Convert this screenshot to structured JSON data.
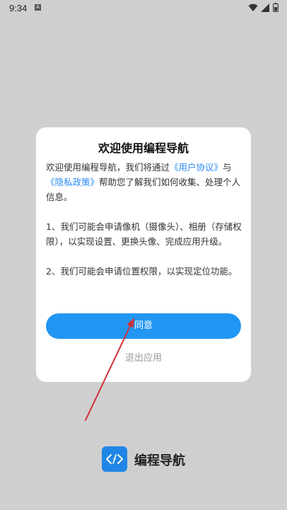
{
  "status_bar": {
    "time": "9:34",
    "notification_icon": "a-box-icon",
    "wifi_icon": "wifi-icon",
    "signal_icon": "signal-icon",
    "battery_icon": "battery-icon"
  },
  "dialog": {
    "title": "欢迎使用编程导航",
    "intro_prefix": "欢迎使用编程导航，我们将通过",
    "user_agreement_link": "《用户协议》",
    "intro_and": "与",
    "privacy_policy_link": "《隐私政策》",
    "intro_suffix": "帮助您了解我们如何收集、处理个人信息。",
    "point_1": "1、我们可能会申请像机（摄像头）、相册（存储权限），以实现设置、更换头像、完成应用升级。",
    "point_2": "2、我们可能会申请位置权限，以实现定位功能。",
    "agree_label": "同意",
    "exit_label": "退出应用"
  },
  "brand": {
    "name": "编程导航",
    "logo_icon": "code-brackets-icon"
  },
  "colors": {
    "accent": "#2196f3",
    "link": "#2a8bf2",
    "overlay": "#cfcfcf",
    "annotation_arrow": "#d0303a"
  }
}
